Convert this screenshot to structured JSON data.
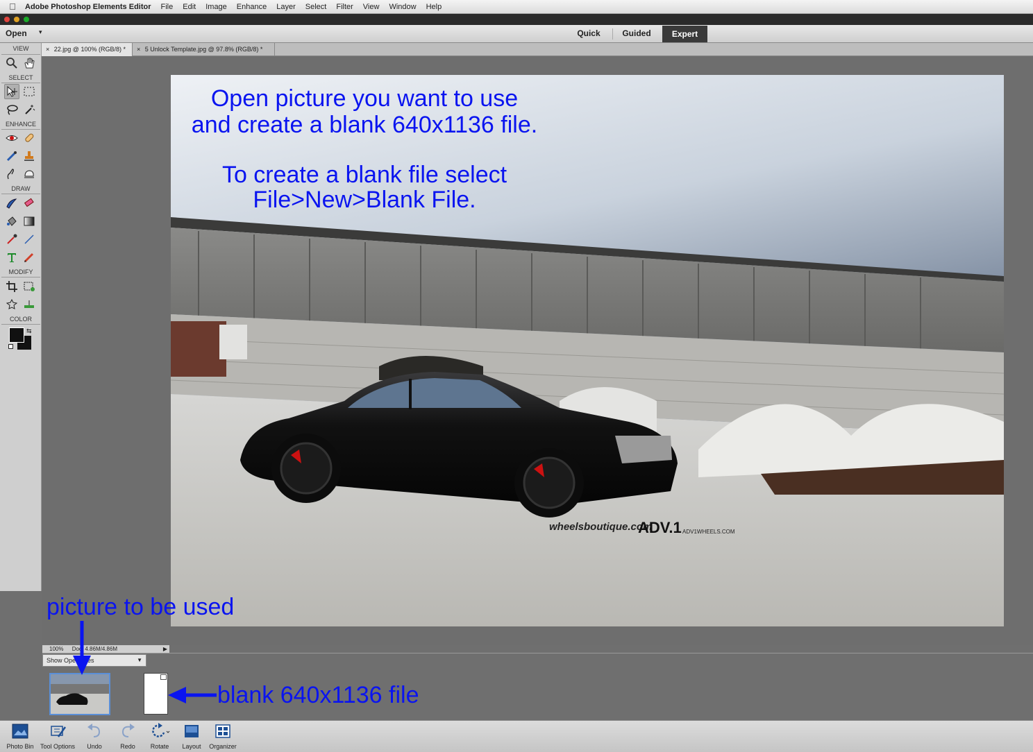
{
  "menubar": {
    "app_name": "Adobe Photoshop Elements Editor",
    "items": [
      "File",
      "Edit",
      "Image",
      "Enhance",
      "Layer",
      "Select",
      "Filter",
      "View",
      "Window",
      "Help"
    ]
  },
  "appbar": {
    "open_label": "Open",
    "modes": [
      "Quick",
      "Guided",
      "Expert"
    ],
    "active_mode": "Expert"
  },
  "toolpanel": {
    "sections": [
      "VIEW",
      "SELECT",
      "ENHANCE",
      "DRAW",
      "MODIFY",
      "COLOR"
    ],
    "foreground_color": "#111111",
    "background_color": "#111111"
  },
  "tabs": [
    {
      "close": "×",
      "label": "22.jpg @ 100% (RGB/8) *"
    },
    {
      "close": "×",
      "label": "5 Unlock Template.jpg @ 97.8% (RGB/8) *"
    }
  ],
  "annotations": {
    "line1": "Open picture you want to use",
    "line2": "and create a blank 640x1136 file.",
    "line3": "To create a blank file select",
    "line4": "File>New>Blank File.",
    "picture_label": "picture to be used",
    "blank_label": "blank 640x1136 file",
    "color": "#0a14f0"
  },
  "photo": {
    "watermark_left": "wheelsboutique.com",
    "watermark_brand": "ADV.1",
    "watermark_right": "ADV1WHEELS.COM"
  },
  "status": {
    "zoom": "100%",
    "doc": "Doc: 4.86M/4.86M",
    "arrow": "▶"
  },
  "photobin": {
    "dropdown_value": "Show Open Files"
  },
  "taskbar": {
    "buttons": [
      "Photo Bin",
      "Tool Options",
      "Undo",
      "Redo",
      "Rotate",
      "Layout",
      "Organizer"
    ]
  }
}
